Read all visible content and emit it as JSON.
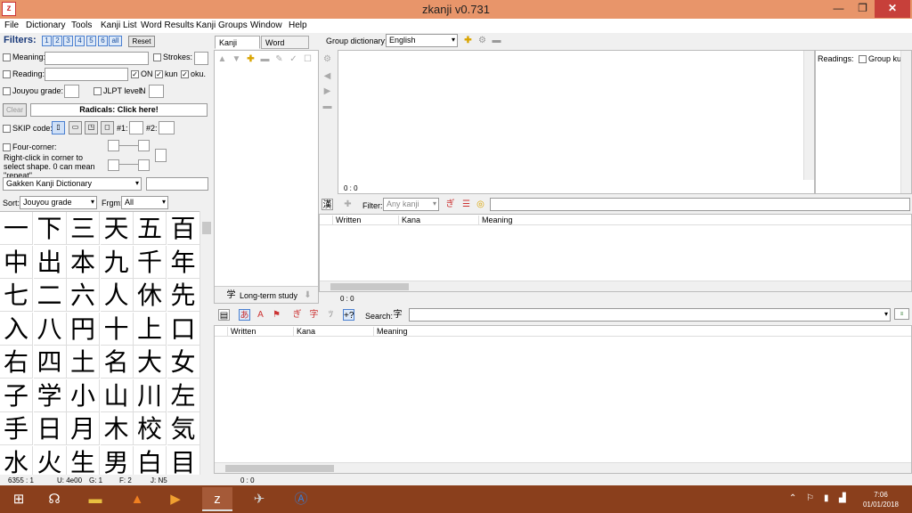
{
  "window": {
    "title": "zkanji v0.731"
  },
  "menu": [
    "File",
    "Dictionary",
    "Tools",
    "Kanji List",
    "Word Results",
    "Kanji Groups",
    "Window",
    "Help"
  ],
  "filters": {
    "label": "Filters:",
    "grade_buttons": [
      "1",
      "2",
      "3",
      "4",
      "5",
      "6",
      "all"
    ],
    "reset": "Reset",
    "meaning_label": "Meaning:",
    "strokes_label": "Strokes:",
    "reading_label": "Reading:",
    "on_label": "ON",
    "kun_label": "kun",
    "oku_label": "oku.",
    "jouyou_label": "Jouyou grade:",
    "jlpt_label": "JLPT level:",
    "jlpt_prefix": "N",
    "clear": "Clear",
    "radicals": "Radicals: Click here!",
    "skip_label": "SKIP code:",
    "hash1": "#1:",
    "hash2": "#2:",
    "four_corner_label": "Four-corner:",
    "four_corner_help": "Right-click in corner to select shape. 0 can mean \"repeat\".",
    "dictionary_select": "Gakken Kanji Dictionary",
    "sort_label": "Sort:",
    "sort_value": "Jouyou grade",
    "frgm_label": "Frgm:",
    "frgm_value": "All"
  },
  "kanji": [
    "一",
    "下",
    "三",
    "天",
    "五",
    "百",
    "中",
    "出",
    "本",
    "九",
    "千",
    "年",
    "七",
    "二",
    "六",
    "人",
    "休",
    "先",
    "入",
    "八",
    "円",
    "十",
    "上",
    "口",
    "右",
    "四",
    "土",
    "名",
    "大",
    "女",
    "子",
    "学",
    "小",
    "山",
    "川",
    "左",
    "手",
    "日",
    "月",
    "木",
    "校",
    "気",
    "水",
    "火",
    "生",
    "男",
    "白",
    "目"
  ],
  "kanji_status": {
    "count": "6355 : 1",
    "unicode": "U: 4e00",
    "grade": "G: 1",
    "freq": "F: 2",
    "jlpt": "J: N5"
  },
  "groups": {
    "tab_kanji": "Kanji groups",
    "tab_words": "Word groups",
    "group_dict_label": "Group dictionary:",
    "group_dict_value": "English",
    "long_term": "Long-term study",
    "readings_label": "Readings:",
    "group_kun": "Group kun",
    "pos1": "0 : 0"
  },
  "words_mid": {
    "filter_label": "Filter:",
    "filter_value": "Any kanji",
    "cols": [
      "Written",
      "Kana",
      "Meaning"
    ],
    "pos": "0 : 0"
  },
  "words_bottom": {
    "search_label": "Search:",
    "cols": [
      "Written",
      "Kana",
      "Meaning"
    ],
    "pos": "0 : 0"
  },
  "taskbar": {
    "time": "7:06",
    "date": "01/01/2018"
  }
}
